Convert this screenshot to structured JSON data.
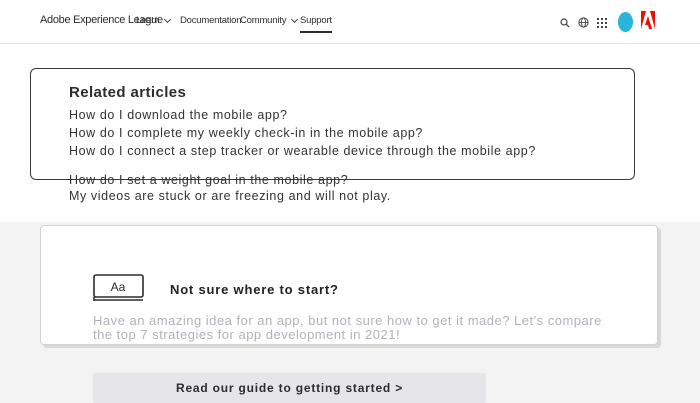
{
  "nav": {
    "brand": "Adobe Experience League",
    "items": [
      {
        "label": "Learn",
        "has_dropdown": true
      },
      {
        "label": "Documentation",
        "has_dropdown": false
      },
      {
        "label": "Community",
        "has_dropdown": true
      },
      {
        "label": "Support",
        "has_dropdown": false,
        "active": true
      }
    ],
    "icons": [
      "search-icon",
      "globe-icon",
      "apps-grid-icon",
      "avatar",
      "adobe-logo-icon"
    ]
  },
  "colors": {
    "accent_avatar": "#29b4d8",
    "adobe_red": "#eb1000",
    "nav_bg": "#ffffff",
    "page_bg": "#f3f3f4",
    "cta_bg": "#e5e5ea"
  },
  "related": {
    "title": "Related articles",
    "articles": [
      "How do I download the mobile app?",
      "How do I complete my weekly check-in in the mobile app?",
      "How do I connect a step tracker or wearable device through the mobile app?",
      "How do I set a weight goal in the mobile app?",
      "My videos are stuck or are freezing and will not play."
    ]
  },
  "guide": {
    "icon_label": "Aa",
    "title": "Not sure where to start?",
    "body": "Have an amazing idea for an app, but not sure how to get it made? Let's compare the top 7 strategies for app development in 2021!",
    "cta_label": "Read our guide to getting started >"
  }
}
